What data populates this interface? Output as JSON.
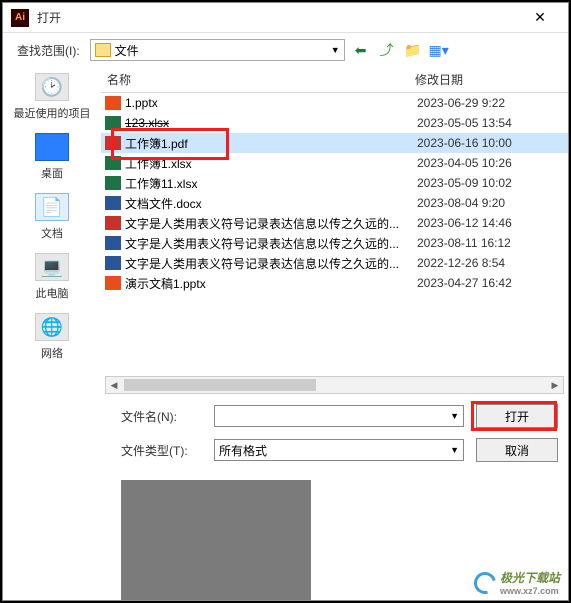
{
  "title": "打开",
  "toolbar": {
    "range_label": "查找范围(I):",
    "path": "文件"
  },
  "sidebar": [
    {
      "label": "最近使用的项目",
      "icon": "recent"
    },
    {
      "label": "桌面",
      "icon": "desktop"
    },
    {
      "label": "文档",
      "icon": "documents"
    },
    {
      "label": "此电脑",
      "icon": "thispc"
    },
    {
      "label": "网络",
      "icon": "network"
    }
  ],
  "columns": {
    "name": "名称",
    "date": "修改日期"
  },
  "files": [
    {
      "name": "1.pptx",
      "date": "2023-06-29 9:22",
      "type": "ppt",
      "selected": false,
      "struck": false
    },
    {
      "name": "123.xlsx",
      "date": "2023-05-05 13:54",
      "type": "xls",
      "selected": false,
      "struck": true
    },
    {
      "name": "工作簿1.pdf",
      "date": "2023-06-16 10:00",
      "type": "pdf",
      "selected": true,
      "struck": false
    },
    {
      "name": "工作簿1.xlsx",
      "date": "2023-04-05 10:26",
      "type": "xls",
      "selected": false,
      "struck": false
    },
    {
      "name": "工作簿11.xlsx",
      "date": "2023-05-09 10:02",
      "type": "xls",
      "selected": false,
      "struck": false
    },
    {
      "name": "文档文件.docx",
      "date": "2023-08-04 9:20",
      "type": "doc",
      "selected": false,
      "struck": false
    },
    {
      "name": "文字是人类用表义符号记录表达信息以传之久远的...",
      "date": "2023-06-12 14:46",
      "type": "pdf",
      "selected": false,
      "struck": false
    },
    {
      "name": "文字是人类用表义符号记录表达信息以传之久远的...",
      "date": "2023-08-11 16:12",
      "type": "doc",
      "selected": false,
      "struck": false
    },
    {
      "name": "文字是人类用表义符号记录表达信息以传之久远的...",
      "date": "2022-12-26 8:54",
      "type": "doc",
      "selected": false,
      "struck": false
    },
    {
      "name": "演示文稿1.pptx",
      "date": "2023-04-27 16:42",
      "type": "ppt",
      "selected": false,
      "struck": false
    }
  ],
  "form": {
    "filename_label": "文件名(N):",
    "filename_value": "",
    "filetype_label": "文件类型(T):",
    "filetype_value": "所有格式",
    "open_btn": "打开",
    "cancel_btn": "取消"
  },
  "watermark": {
    "text": "极光下载站",
    "url": "www.xz7.com"
  }
}
